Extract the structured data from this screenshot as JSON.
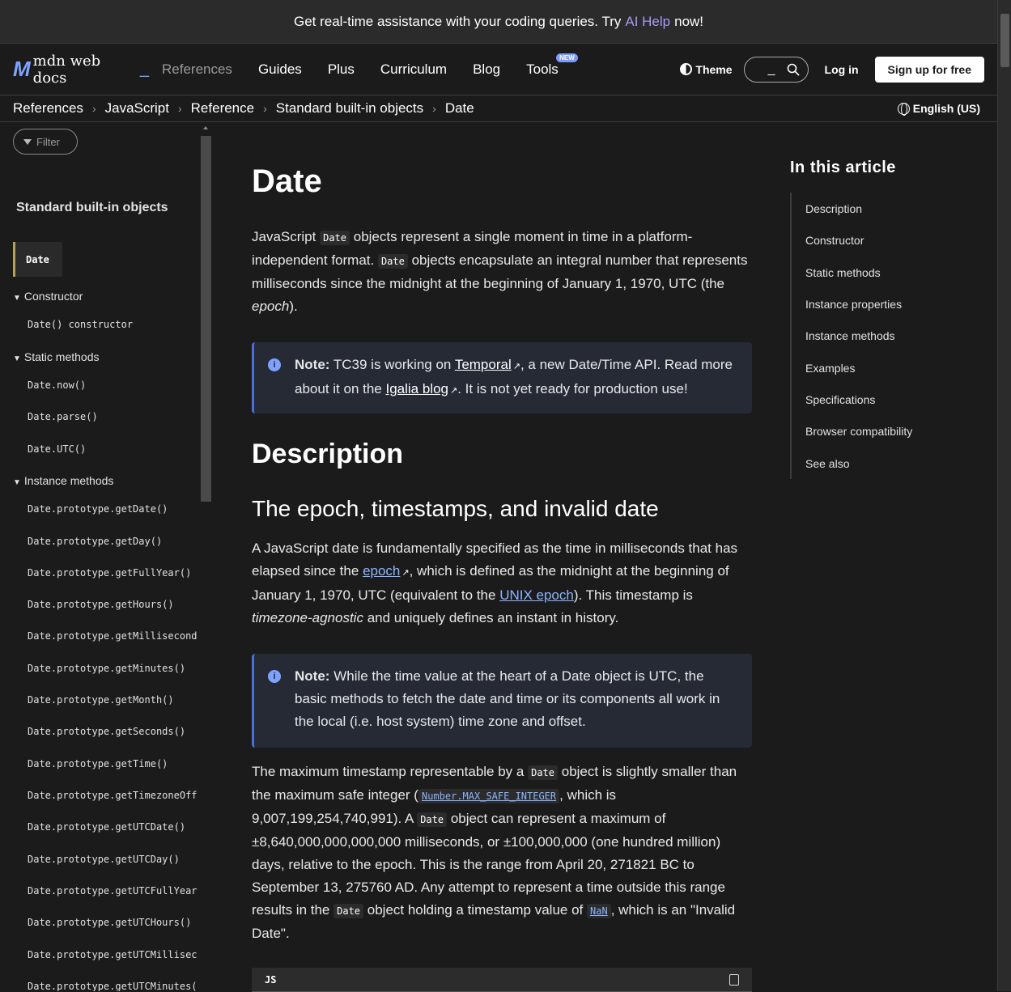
{
  "banner": {
    "pre": "Get real-time assistance with your coding queries. Try",
    "link": "AI Help",
    "post": "now!"
  },
  "nav": {
    "logo_text": "mdn web docs",
    "items": [
      "References",
      "Guides",
      "Plus",
      "Curriculum",
      "Blog",
      "Tools"
    ],
    "new_badge": "NEW",
    "theme": "Theme",
    "login": "Log in",
    "signup": "Sign up for free"
  },
  "breadcrumbs": [
    "References",
    "JavaScript",
    "Reference",
    "Standard built-in objects",
    "Date"
  ],
  "language": "English (US)",
  "sidebar": {
    "filter_placeholder": "Filter",
    "title": "Standard built-in objects",
    "current": "Date",
    "groups": {
      "constructor": "Constructor",
      "static": "Static methods",
      "instance": "Instance methods"
    },
    "constructor_items": [
      "Date() constructor"
    ],
    "static_items": [
      "Date.now()",
      "Date.parse()",
      "Date.UTC()"
    ],
    "instance_items": [
      "Date.prototype.getDate()",
      "Date.prototype.getDay()",
      "Date.prototype.getFullYear()",
      "Date.prototype.getHours()",
      "Date.prototype.getMillisecond",
      "Date.prototype.getMinutes()",
      "Date.prototype.getMonth()",
      "Date.prototype.getSeconds()",
      "Date.prototype.getTime()",
      "Date.prototype.getTimezoneOff",
      "Date.prototype.getUTCDate()",
      "Date.prototype.getUTCDay()",
      "Date.prototype.getUTCFullYear",
      "Date.prototype.getUTCHours()",
      "Date.prototype.getUTCMillisec",
      "Date.prototype.getUTCMinutes("
    ]
  },
  "article": {
    "title": "Date",
    "intro": {
      "t1": "JavaScript",
      "code1": "Date",
      "t2": "objects represent a single moment in time in a platform-independent format.",
      "code2": "Date",
      "t3": "objects encapsulate an integral number that represents milliseconds since the midnight at the beginning of January 1, 1970, UTC (the",
      "em": "epoch",
      "t4": ")."
    },
    "note1": {
      "label": "Note:",
      "t1": "TC39 is working on",
      "link1": "Temporal",
      "t2": ", a new Date/Time API. Read more about it on the",
      "link2": "Igalia blog",
      "t3": ". It is not yet ready for production use!"
    },
    "h2_description": "Description",
    "h3_epoch": "The epoch, timestamps, and invalid date",
    "p2": {
      "t1": "A JavaScript date is fundamentally specified as the time in milliseconds that has elapsed since the",
      "link1": "epoch",
      "t2": ", which is defined as the midnight at the beginning of January 1, 1970, UTC (equivalent to the",
      "link2": "UNIX epoch",
      "t3": "). This timestamp is",
      "em": "timezone-agnostic",
      "t4": "and uniquely defines an instant in history."
    },
    "note2": {
      "label": "Note:",
      "text": "While the time value at the heart of a Date object is UTC, the basic methods to fetch the date and time or its components all work in the local (i.e. host system) time zone and offset."
    },
    "p3": {
      "t1": "The maximum timestamp representable by a",
      "code1": "Date",
      "t2": "object is slightly smaller than the maximum safe integer (",
      "code2": "Number.MAX_SAFE_INTEGER",
      "t3": ", which is 9,007,199,254,740,991). A",
      "code3": "Date",
      "t4": "object can represent a maximum of ±8,640,000,000,000,000 milliseconds, or ±100,000,000 (one hundred million) days, relative to the epoch. This is the range from April 20, 271821 BC to September 13, 275760 AD. Any attempt to represent a time outside this range results in the",
      "code4": "Date",
      "t5": "object holding a timestamp value of",
      "code5": "NaN",
      "t6": ", which is an \"Invalid Date\"."
    },
    "code_lang": "JS"
  },
  "toc": {
    "title": "In this article",
    "items": [
      "Description",
      "Constructor",
      "Static methods",
      "Instance properties",
      "Instance methods",
      "Examples",
      "Specifications",
      "Browser compatibility",
      "See also"
    ]
  },
  "colors": {
    "accent": "#8cb4ff",
    "note_border": "#4c6fd6",
    "active_marker": "#b6a34f"
  }
}
